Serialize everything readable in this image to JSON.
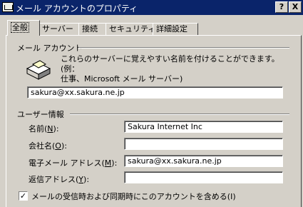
{
  "window": {
    "title": "メール アカウントのプロパティ",
    "help_button": "?",
    "close_button": "X"
  },
  "tabs": [
    {
      "label": "全般"
    },
    {
      "label": "サーバー"
    },
    {
      "label": "接続"
    },
    {
      "label": "セキュリティ"
    },
    {
      "label": "詳細設定"
    }
  ],
  "mail_account": {
    "section_title": "メール アカウント",
    "description_line1": "これらのサーバーに覚えやすい名前を付けることができます。(例：",
    "description_line2": "仕事、Microsoft メール サーバー)",
    "account_name": "sakura@xx.sakura.ne.jp"
  },
  "user_info": {
    "section_title": "ユーザー情報",
    "name_label": "名前(",
    "name_key": "N",
    "name_value": "Sakura Internet Inc",
    "company_label": "会社名(",
    "company_key": "O",
    "company_value": "",
    "email_label": "電子メール アドレス(",
    "email_key": "M",
    "email_value": "sakura@xx.sakura.ne.jp",
    "reply_label": "返信アドレス(",
    "reply_key": "Y",
    "reply_value": "",
    "label_close": "):"
  },
  "include_account": {
    "label": "メールの受信時および同期時にこのアカウントを含める(I)",
    "checked": true,
    "check_mark": "✓"
  }
}
